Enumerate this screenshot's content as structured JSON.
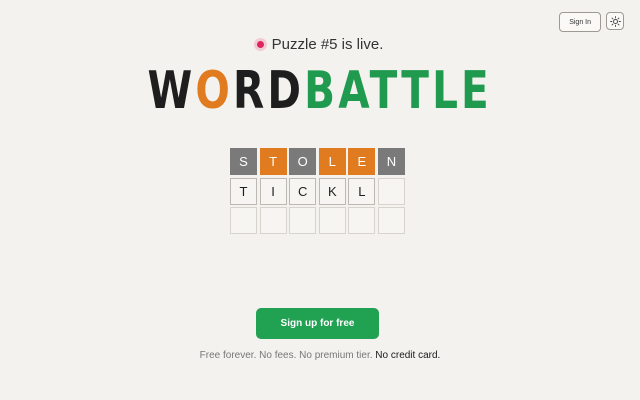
{
  "header": {
    "sign_in_label": "Sign In",
    "theme_icon": "sun-icon"
  },
  "announcement": {
    "text": "Puzzle #5 is live.",
    "dot_color": "#e0245e"
  },
  "logo": {
    "w": "W",
    "o": "O",
    "rd": "RD",
    "battle": "BATTLE",
    "colors": {
      "dark": "#1e1e1e",
      "orange": "#e07b1f",
      "green": "#1f9a4f"
    }
  },
  "board": {
    "rows": [
      [
        {
          "letter": "S",
          "state": "absent"
        },
        {
          "letter": "T",
          "state": "present"
        },
        {
          "letter": "O",
          "state": "absent"
        },
        {
          "letter": "L",
          "state": "present"
        },
        {
          "letter": "E",
          "state": "present"
        },
        {
          "letter": "N",
          "state": "absent"
        }
      ],
      [
        {
          "letter": "T",
          "state": "filled"
        },
        {
          "letter": "I",
          "state": "filled"
        },
        {
          "letter": "C",
          "state": "filled"
        },
        {
          "letter": "K",
          "state": "filled"
        },
        {
          "letter": "L",
          "state": "filled"
        },
        {
          "letter": "",
          "state": "empty"
        }
      ],
      [
        {
          "letter": "",
          "state": "empty"
        },
        {
          "letter": "",
          "state": "empty"
        },
        {
          "letter": "",
          "state": "empty"
        },
        {
          "letter": "",
          "state": "empty"
        },
        {
          "letter": "",
          "state": "empty"
        },
        {
          "letter": "",
          "state": "empty"
        }
      ]
    ],
    "colors": {
      "absent": "#7a7a7a",
      "present": "#e07b1f"
    }
  },
  "cta": {
    "label": "Sign up for free",
    "color": "#21a152"
  },
  "footer": {
    "text": "Free forever. No fees. No premium tier.",
    "emphasis": "No credit card."
  }
}
